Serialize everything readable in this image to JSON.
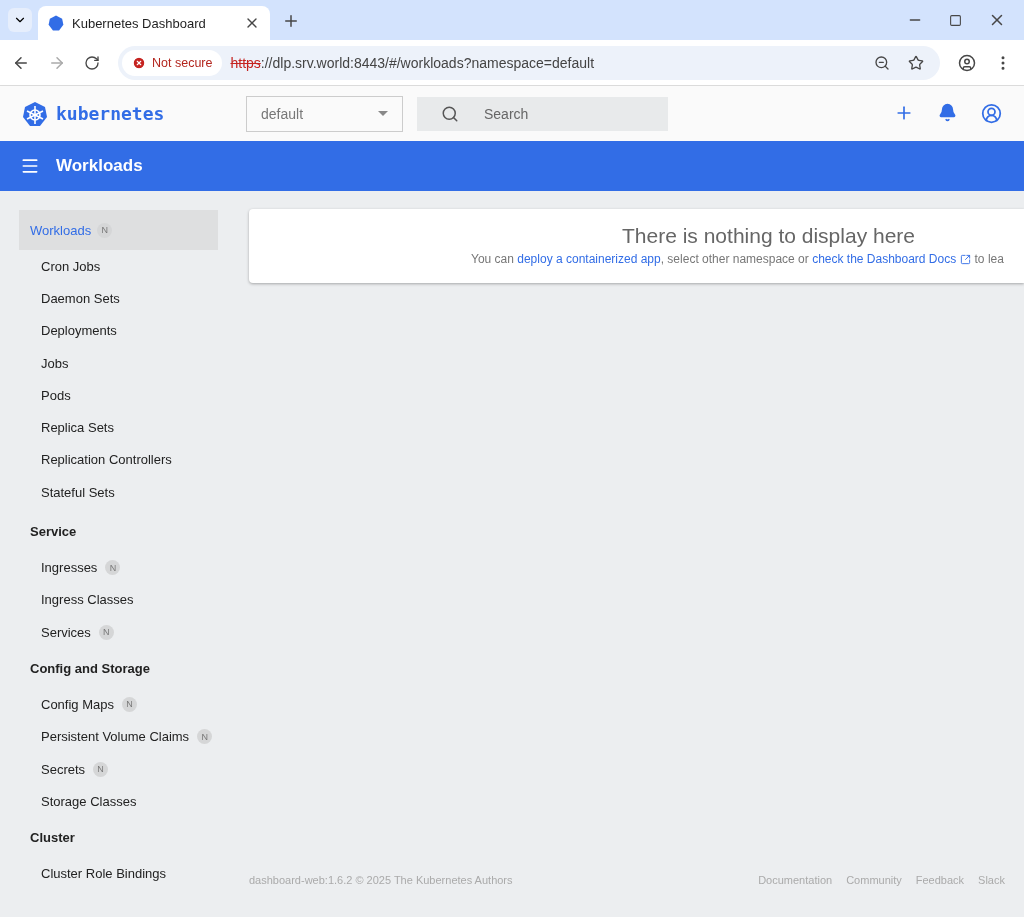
{
  "browser": {
    "tab": {
      "title": "Kubernetes Dashboard",
      "selected": true
    },
    "security": "Not secure",
    "url_scheme": "https",
    "url_rest": "://dlp.srv.world:8443/#/workloads?namespace=default"
  },
  "header": {
    "brand": "kubernetes",
    "namespace": "default",
    "search": {
      "placeholder": "Search"
    }
  },
  "toolbar": {
    "title": "Workloads"
  },
  "sidebar": {
    "sections": [
      {
        "title": "Workloads",
        "badge": "N",
        "selected": true,
        "items": [
          {
            "label": "Cron Jobs"
          },
          {
            "label": "Daemon Sets"
          },
          {
            "label": "Deployments"
          },
          {
            "label": "Jobs"
          },
          {
            "label": "Pods"
          },
          {
            "label": "Replica Sets"
          },
          {
            "label": "Replication Controllers"
          },
          {
            "label": "Stateful Sets"
          }
        ]
      },
      {
        "title": "Service",
        "selected": false,
        "items": [
          {
            "label": "Ingresses",
            "badge": "N"
          },
          {
            "label": "Ingress Classes"
          },
          {
            "label": "Services",
            "badge": "N"
          }
        ]
      },
      {
        "title": "Config and Storage",
        "selected": false,
        "items": [
          {
            "label": "Config Maps",
            "badge": "N"
          },
          {
            "label": "Persistent Volume Claims",
            "badge": "N"
          },
          {
            "label": "Secrets",
            "badge": "N"
          },
          {
            "label": "Storage Classes"
          }
        ]
      },
      {
        "title": "Cluster",
        "selected": false,
        "items": [
          {
            "label": "Cluster Role Bindings"
          }
        ]
      }
    ]
  },
  "empty_state": {
    "title": "There is nothing to display here",
    "message": [
      {
        "kind": "text",
        "text": "You can "
      },
      {
        "kind": "link",
        "text": "deploy a containerized app"
      },
      {
        "kind": "text",
        "text": ", select other namespace or "
      },
      {
        "kind": "link",
        "text": "check the Dashboard Docs",
        "external": true
      },
      {
        "kind": "text",
        "text": " to lea"
      }
    ]
  },
  "footer": {
    "copyright": "dashboard-web:1.6.2 © 2025 The Kubernetes Authors",
    "links": [
      "Documentation",
      "Community",
      "Feedback",
      "Slack"
    ]
  }
}
